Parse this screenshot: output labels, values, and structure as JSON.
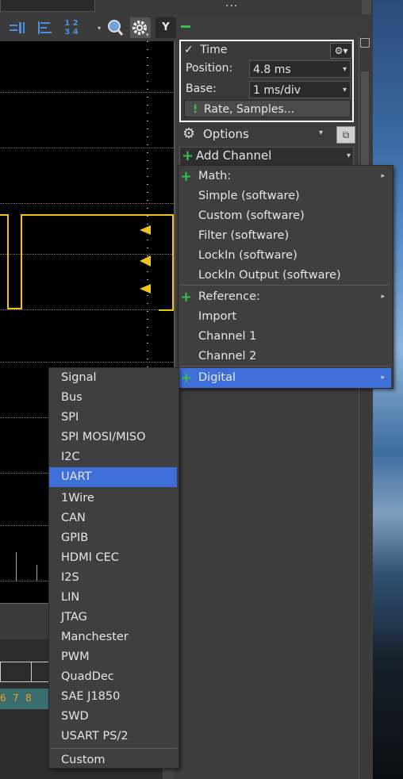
{
  "toolbar": {
    "icons": [
      "cursors-icon",
      "align-icon",
      "numbering-icon",
      "zoom-icon",
      "gear-icon"
    ],
    "y_label": "Y",
    "numbering_top": "1 2",
    "numbering_bottom": "3 4"
  },
  "topbar": {
    "dots": "..."
  },
  "time": {
    "header": "Time",
    "check": "✓",
    "position_label": "Position:",
    "position_value": "4.8 ms",
    "base_label": "Base:",
    "base_value": "1 ms/div",
    "rate_button": "Rate, Samples...",
    "rate_icon": "!"
  },
  "options": {
    "label": "Options"
  },
  "add_channel": {
    "label": "Add Channel"
  },
  "add_channel_menu": {
    "items": [
      {
        "label": "Math:",
        "plus": true,
        "submenu": true
      },
      {
        "label": "Simple (software)"
      },
      {
        "label": "Custom (software)"
      },
      {
        "label": "Filter (software)"
      },
      {
        "label": "LockIn (software)"
      },
      {
        "label": "LockIn Output (software)"
      },
      {
        "label": "Reference:",
        "plus": true,
        "submenu": true
      },
      {
        "label": "Import"
      },
      {
        "label": "Channel 1"
      },
      {
        "label": "Channel 2"
      },
      {
        "label": "Digital",
        "plus": true,
        "submenu": true,
        "highlighted": true
      }
    ]
  },
  "digital_menu": {
    "items": [
      "Signal",
      "Bus",
      "SPI",
      "SPI MOSI/MISO",
      "I2C",
      "UART",
      "1Wire",
      "CAN",
      "GPIB",
      "HDMI CEC",
      "I2S",
      "LIN",
      "JTAG",
      "Manchester",
      "PWM",
      "QuadDec",
      "SAE J1850",
      "SWD",
      "USART PS/2",
      "Custom"
    ],
    "highlighted": "UART"
  },
  "bus_numbers": [
    "6",
    "7",
    "8"
  ],
  "colors": {
    "accent": "#3e6fd8",
    "trace": "#f2c21b",
    "plus": "#37c24a",
    "bus": "#3a6e6e"
  }
}
